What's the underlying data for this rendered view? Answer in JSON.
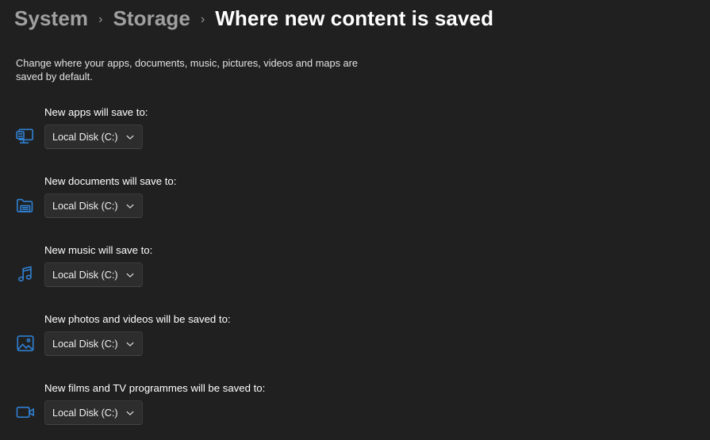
{
  "breadcrumb": {
    "items": [
      {
        "label": "System",
        "current": false
      },
      {
        "label": "Storage",
        "current": false
      },
      {
        "label": "Where new content is saved",
        "current": true
      }
    ],
    "separator": "›"
  },
  "description": "Change where your apps, documents, music, pictures, videos and maps are saved by default.",
  "colors": {
    "background": "#202020",
    "control_background": "#2d2d2d",
    "control_border": "#3a3a3a",
    "accent_icon": "#2f7fd1",
    "text_primary": "#ffffff",
    "text_secondary": "#a0a0a0"
  },
  "settings": [
    {
      "label": "New apps will save to:",
      "icon": "monitor-apps-icon",
      "value": "Local Disk (C:)"
    },
    {
      "label": "New documents will save to:",
      "icon": "folder-documents-icon",
      "value": "Local Disk (C:)"
    },
    {
      "label": "New music will save to:",
      "icon": "music-note-icon",
      "value": "Local Disk (C:)"
    },
    {
      "label": "New photos and videos will be saved to:",
      "icon": "picture-icon",
      "value": "Local Disk (C:)"
    },
    {
      "label": "New films and TV programmes will be saved to:",
      "icon": "video-camera-icon",
      "value": "Local Disk (C:)"
    }
  ]
}
